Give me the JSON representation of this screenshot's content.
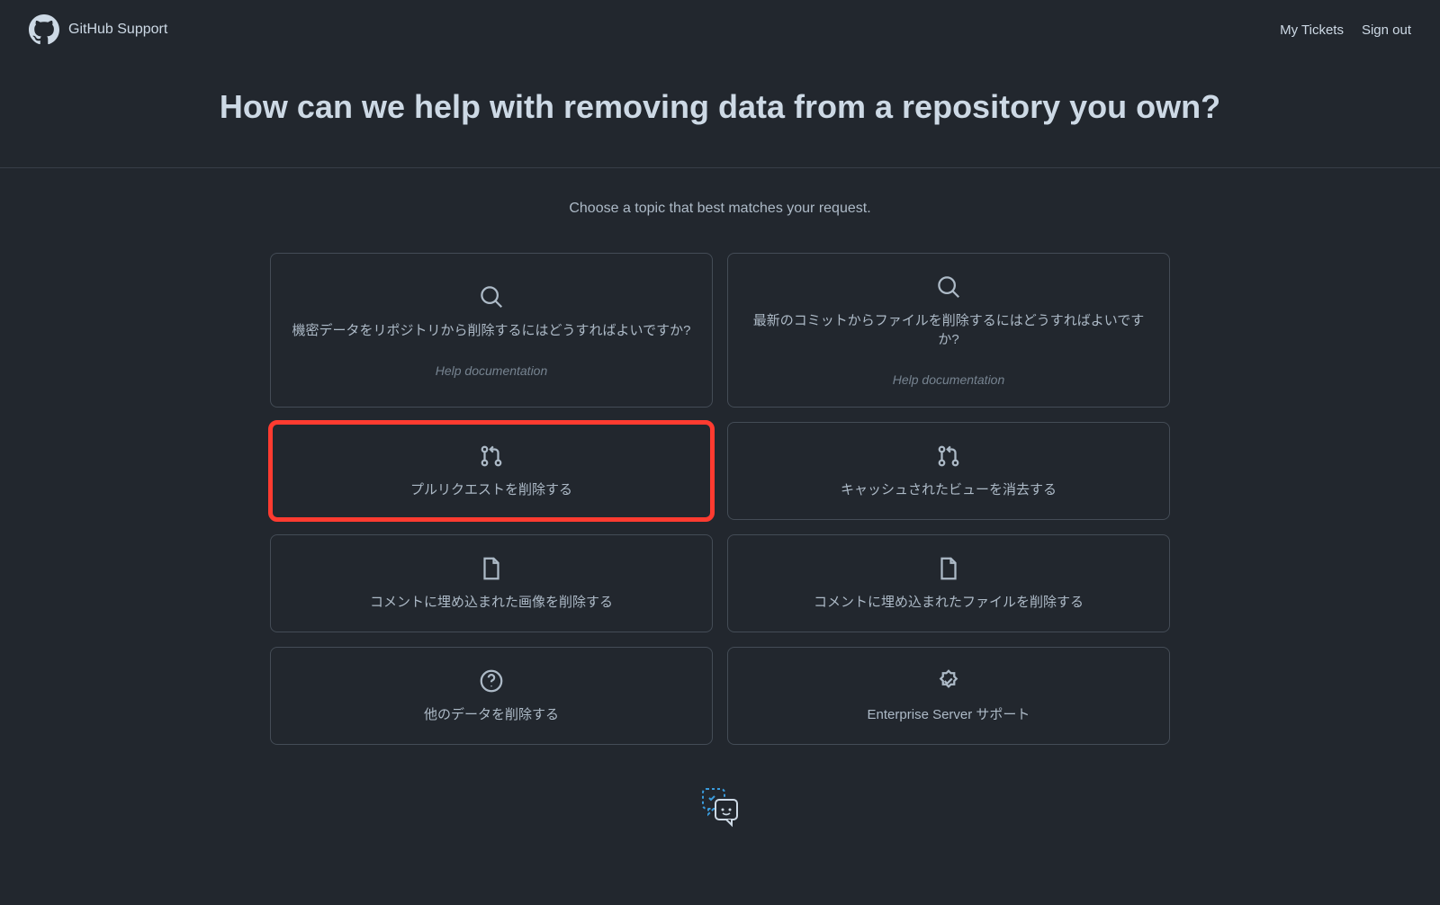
{
  "header": {
    "brand": "GitHub Support",
    "links": {
      "my_tickets": "My Tickets",
      "sign_out": "Sign out"
    }
  },
  "hero": {
    "title": "How can we help with removing data from a repository you own?"
  },
  "content": {
    "subtitle": "Choose a topic that best matches your request.",
    "help_doc_label": "Help documentation",
    "cards": [
      {
        "title": "機密データをリポジトリから削除するにはどうすればよいですか?",
        "sub": true
      },
      {
        "title": "最新のコミットからファイルを削除するにはどうすればよいですか?",
        "sub": true
      },
      {
        "title": "プルリクエストを削除する",
        "sub": false
      },
      {
        "title": "キャッシュされたビューを消去する",
        "sub": false
      },
      {
        "title": "コメントに埋め込まれた画像を削除する",
        "sub": false
      },
      {
        "title": "コメントに埋め込まれたファイルを削除する",
        "sub": false
      },
      {
        "title": "他のデータを削除する",
        "sub": false
      },
      {
        "title": "Enterprise Server サポート",
        "sub": false
      }
    ]
  }
}
